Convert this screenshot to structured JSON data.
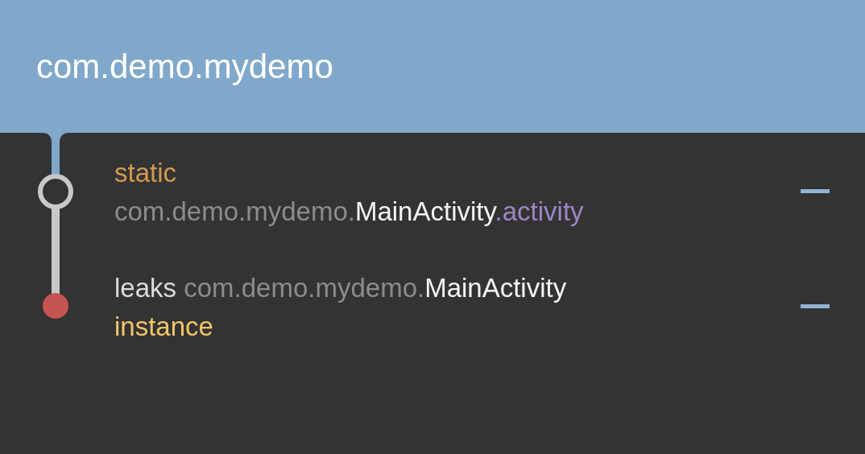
{
  "header": {
    "title": "com.demo.mydemo"
  },
  "rows": [
    {
      "kind": "reference",
      "lines": [
        [
          {
            "kind": "keyword",
            "text": "static"
          }
        ],
        [
          {
            "kind": "package",
            "text": "com.demo.mydemo."
          },
          {
            "kind": "class",
            "text": "MainActivity"
          },
          {
            "kind": "field",
            "text": ".activity"
          }
        ]
      ]
    },
    {
      "kind": "leak",
      "lines": [
        [
          {
            "kind": "plain",
            "text": "leaks "
          },
          {
            "kind": "package",
            "text": "com.demo.mydemo."
          },
          {
            "kind": "class",
            "text": "MainActivity"
          }
        ],
        [
          {
            "kind": "instance",
            "text": "instance"
          }
        ]
      ]
    }
  ]
}
